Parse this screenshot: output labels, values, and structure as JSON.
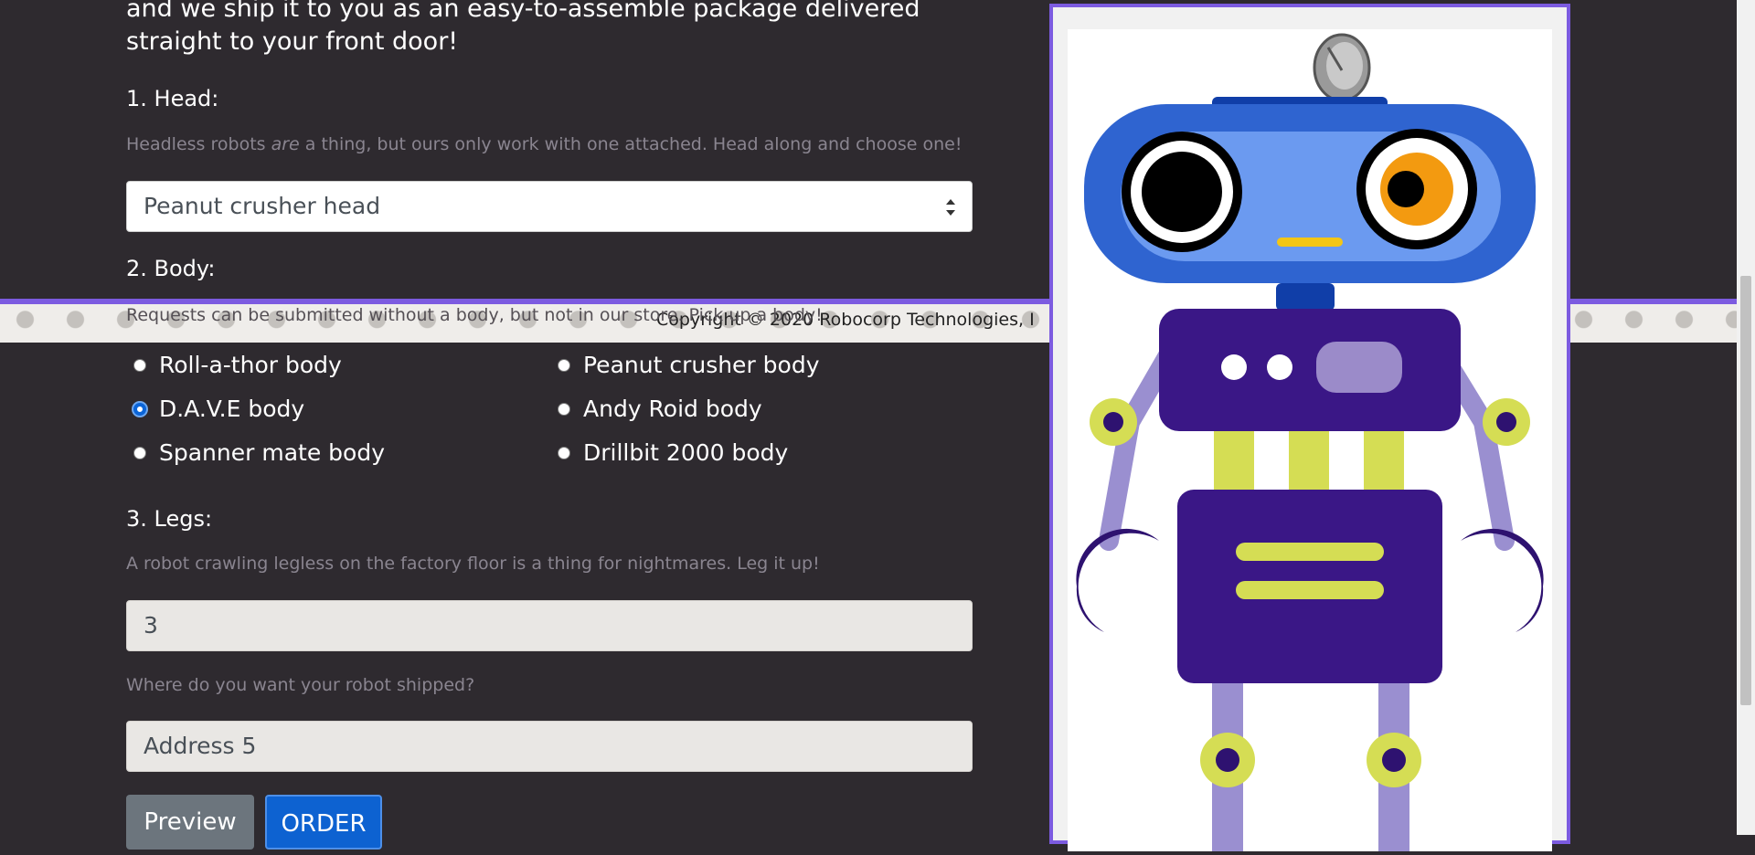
{
  "intro": {
    "text": "and we ship it to you as an easy-to-assemble package delivered straight to your front door!"
  },
  "head": {
    "label": "1. Head:",
    "hint_before": "Headless robots ",
    "hint_em": "are",
    "hint_after": " a thing, but ours only work with one attached. Head along and choose one!",
    "selected": "Peanut crusher head"
  },
  "body": {
    "label": "2. Body:",
    "hint": "Requests can be submitted without a body, but not in our store. Pick up a body!",
    "options": [
      {
        "label": "Roll-a-thor body",
        "checked": false
      },
      {
        "label": "Peanut crusher body",
        "checked": false
      },
      {
        "label": "D.A.V.E body",
        "checked": true
      },
      {
        "label": "Andy Roid body",
        "checked": false
      },
      {
        "label": "Spanner mate body",
        "checked": false
      },
      {
        "label": "Drillbit 2000 body",
        "checked": false
      }
    ]
  },
  "legs": {
    "label": "3. Legs:",
    "hint": "A robot crawling legless on the factory floor is a thing for nightmares. Leg it up!",
    "value": "3"
  },
  "address": {
    "hint": "Where do you want your robot shipped?",
    "value": "Address 5"
  },
  "buttons": {
    "preview": "Preview",
    "order": "ORDER"
  },
  "footer": {
    "text": "Copyright © 2020 Robocorp Technologies, I"
  },
  "colors": {
    "accent": "#7c5be0",
    "order_button": "#0d62d1",
    "preview_button": "#6c757d",
    "background": "#2e2a2f"
  }
}
